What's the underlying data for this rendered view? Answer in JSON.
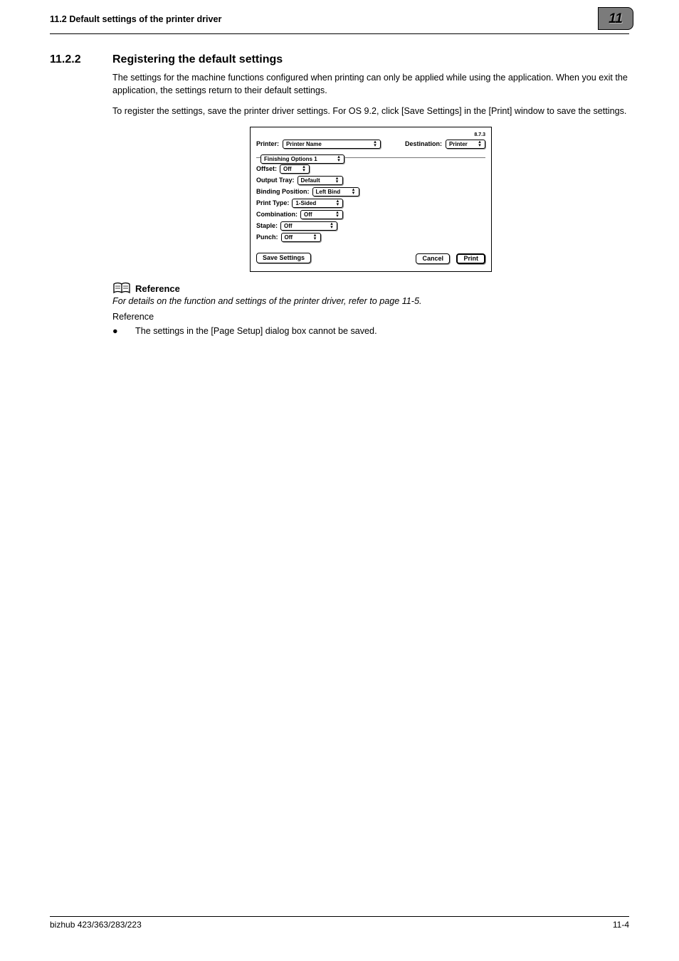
{
  "header": {
    "left": "11.2    Default settings of the printer driver",
    "badge": "11"
  },
  "section": {
    "num": "11.2.2",
    "title": "Registering the default settings",
    "p1": "The settings for the machine functions configured when printing can only be applied while using the application. When you exit the application, the settings return to their default settings.",
    "p2": "To register the settings, save the printer driver settings. For OS 9.2, click [Save Settings] in the [Print] window to save the settings."
  },
  "dialog": {
    "version": "8.7.3",
    "printer_label": "Printer:",
    "printer_value": "Printer Name",
    "destination_label": "Destination:",
    "destination_value": "Printer",
    "group": "Finishing Options 1",
    "offset_label": "Offset:",
    "offset_value": "Off",
    "output_tray_label": "Output Tray:",
    "output_tray_value": "Default",
    "binding_pos_label": "Binding Position:",
    "binding_pos_value": "Left Bind",
    "print_type_label": "Print Type:",
    "print_type_value": "1-Sided",
    "combination_label": "Combination:",
    "combination_value": "Off",
    "staple_label": "Staple:",
    "staple_value": "Off",
    "punch_label": "Punch:",
    "punch_value": "Off",
    "save_btn": "Save Settings",
    "cancel_btn": "Cancel",
    "print_btn": "Print"
  },
  "reference": {
    "heading": "Reference",
    "text": "For details on the function and settings of the printer driver, refer to page 11-5.",
    "sub": "Reference",
    "bullet": "The settings in the [Page Setup] dialog box cannot be saved."
  },
  "footer": {
    "left": "bizhub 423/363/283/223",
    "right": "11-4"
  }
}
